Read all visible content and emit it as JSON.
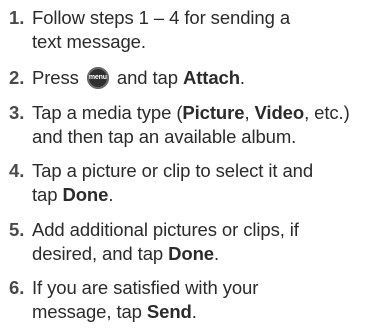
{
  "steps": [
    {
      "num": "1.",
      "lines": [
        [
          {
            "t": "Follow steps 1 – 4  for sending a"
          }
        ],
        [
          {
            "t": "text message."
          }
        ]
      ]
    },
    {
      "num": "2.",
      "lines": [
        [
          {
            "t": "Press "
          },
          {
            "icon": "menu-icon",
            "label": "menu"
          },
          {
            "t": " and tap "
          },
          {
            "t": "Attach",
            "b": true
          },
          {
            "t": "."
          }
        ]
      ]
    },
    {
      "num": "3.",
      "lines": [
        [
          {
            "t": "Tap a media type ("
          },
          {
            "t": "Picture",
            "b": true
          },
          {
            "t": ", "
          },
          {
            "t": "Video",
            "b": true
          },
          {
            "t": ", etc.)"
          }
        ],
        [
          {
            "t": "and then tap an available album."
          }
        ]
      ]
    },
    {
      "num": "4.",
      "lines": [
        [
          {
            "t": "Tap a picture or clip to select it and"
          }
        ],
        [
          {
            "t": "tap "
          },
          {
            "t": "Done",
            "b": true
          },
          {
            "t": "."
          }
        ]
      ]
    },
    {
      "num": "5.",
      "lines": [
        [
          {
            "t": "Add additional pictures or clips, if"
          }
        ],
        [
          {
            "t": "desired, and tap "
          },
          {
            "t": "Done",
            "b": true
          },
          {
            "t": "."
          }
        ]
      ]
    },
    {
      "num": "6.",
      "lines": [
        [
          {
            "t": "If you are satisfied with your"
          }
        ],
        [
          {
            "t": "message, tap "
          },
          {
            "t": "Send",
            "b": true
          },
          {
            "t": "."
          }
        ]
      ]
    }
  ]
}
